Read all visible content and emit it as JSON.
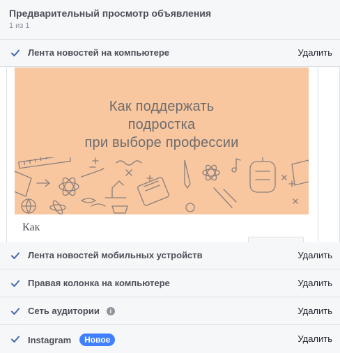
{
  "header": {
    "title": "Предварительный просмотр объявления",
    "pager": "1 из 1"
  },
  "placements": [
    {
      "label": "Лента новостей на компьютере",
      "remove": "Удалить"
    },
    {
      "label": "Лента новостей мобильных устройств",
      "remove": "Удалить"
    },
    {
      "label": "Правая колонка на компьютере",
      "remove": "Удалить"
    },
    {
      "label": "Сеть аудитории",
      "remove": "Удалить",
      "info_icon": "info-icon"
    },
    {
      "label": "Instagram",
      "remove": "Удалить",
      "badge": "Новое"
    }
  ],
  "ad": {
    "headline_line1": "Как поддержать",
    "headline_line2": "подростка",
    "headline_line3": "при выборе профессии",
    "caption": "Как"
  },
  "colors": {
    "accent": "#4267b2",
    "badge": "#4080ff",
    "ad_background": "#f8c7a0",
    "doodle": "#8a7f7b"
  }
}
